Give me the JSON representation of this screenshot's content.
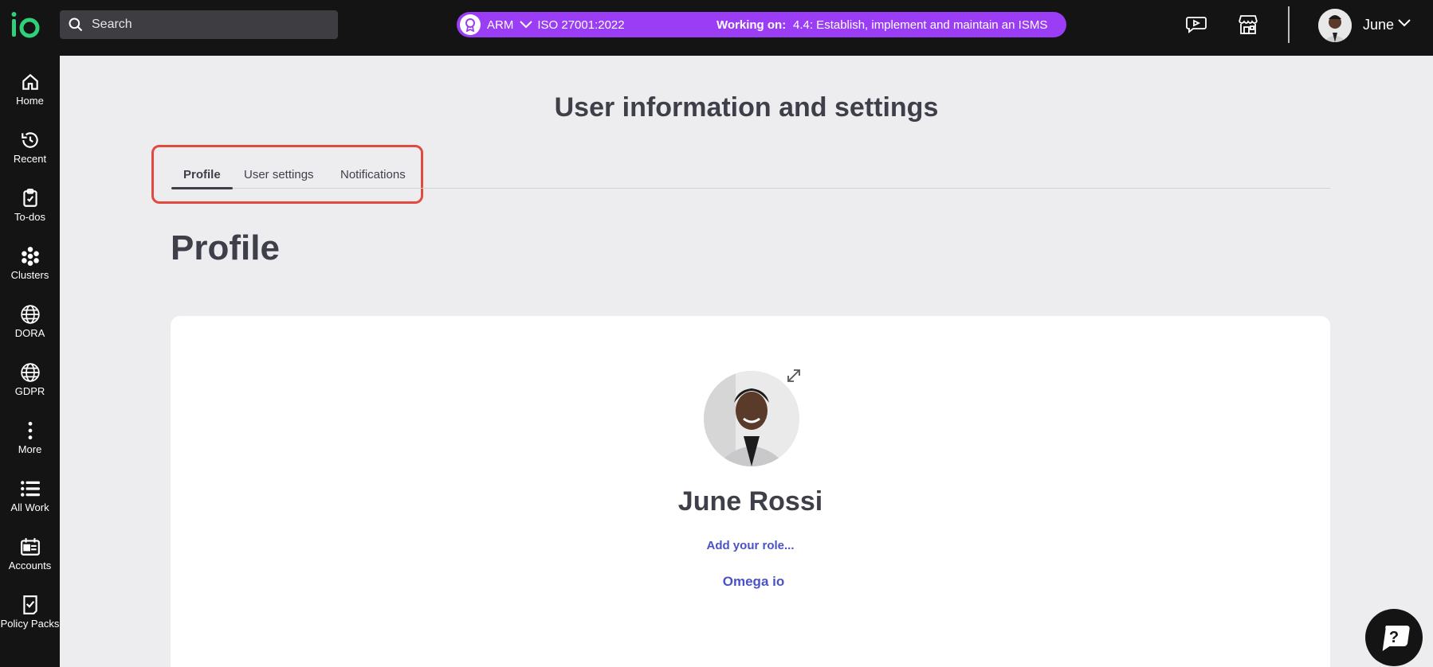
{
  "app": {
    "logo_text": "io"
  },
  "search": {
    "placeholder": "Search"
  },
  "context": {
    "framework_badge": "ARM",
    "standard": "ISO 27001:2022",
    "working_on_label": "Working on:",
    "working_on_task": "4.4: Establish, implement and maintain an ISMS",
    "accent_color": "#9b3df5"
  },
  "header_icons": [
    "video-chat-icon",
    "store-icon"
  ],
  "user": {
    "name": "June"
  },
  "sidebar": {
    "items": [
      {
        "label": "Home",
        "icon": "home-icon"
      },
      {
        "label": "Recent",
        "icon": "history-icon"
      },
      {
        "label": "To-dos",
        "icon": "clipboard-check-icon"
      },
      {
        "label": "Clusters",
        "icon": "clusters-icon"
      },
      {
        "label": "DORA",
        "icon": "globe-icon"
      },
      {
        "label": "GDPR",
        "icon": "globe-icon"
      },
      {
        "label": "More",
        "icon": "more-vertical-icon"
      },
      {
        "label": "All Work",
        "icon": "list-icon"
      },
      {
        "label": "Accounts",
        "icon": "calendar-id-icon"
      },
      {
        "label": "Policy Packs",
        "icon": "policy-icon"
      }
    ]
  },
  "page": {
    "title": "User information and settings",
    "tabs": [
      {
        "label": "Profile",
        "active": true
      },
      {
        "label": "User settings",
        "active": false
      },
      {
        "label": "Notifications",
        "active": false
      }
    ],
    "section_title": "Profile"
  },
  "profile": {
    "full_name": "June Rossi",
    "role_placeholder": "Add your role...",
    "organization": "Omega io"
  },
  "colors": {
    "highlight_border": "#e04a3f",
    "link": "#4b52c7",
    "brand_green": "#2ed07a"
  }
}
